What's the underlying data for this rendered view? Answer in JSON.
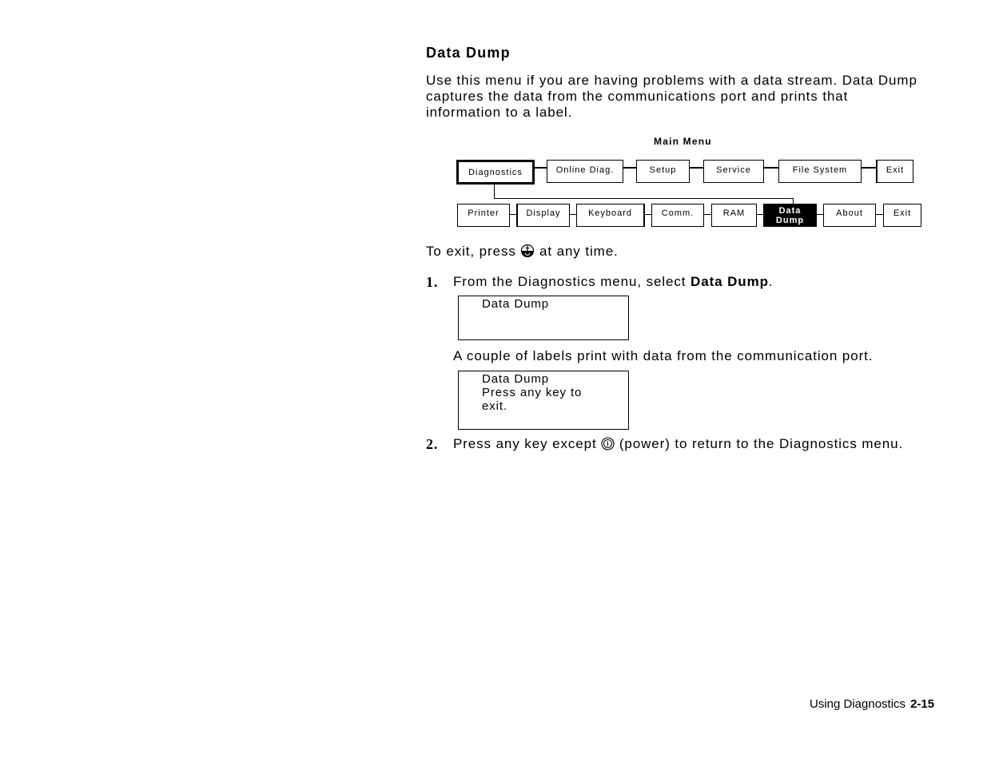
{
  "section": {
    "heading": "Data Dump",
    "intro_lines": [
      "Use this menu if you are having problems with a data stream.  Data Dump",
      "captures the data from the communications port and prints that",
      "information to a label."
    ]
  },
  "diagram": {
    "title": "Main Menu",
    "top_row": [
      {
        "label": "Diagnostics",
        "active": true
      },
      {
        "label": "Online Diag."
      },
      {
        "label": "Setup"
      },
      {
        "label": "Service"
      },
      {
        "label": "File System"
      },
      {
        "label": "Exit"
      }
    ],
    "bottom_row": [
      {
        "label": "Printer"
      },
      {
        "label": "Display"
      },
      {
        "label": "Keyboard"
      },
      {
        "label": "Comm."
      },
      {
        "label": "RAM"
      },
      {
        "label_line1": "Data",
        "label_line2": "Dump",
        "selected": true
      },
      {
        "label": "About"
      },
      {
        "label": "Exit"
      }
    ]
  },
  "exit_note": {
    "before": "To exit, press",
    "icon": "escape-key-icon",
    "after": "at any time."
  },
  "steps": [
    {
      "number": "1.",
      "text_before": "From the Diagnostics menu, select ",
      "text_bold": "Data Dump",
      "text_after": ".",
      "display1": [
        "Data Dump"
      ],
      "note": "A couple of labels print with data from the communication port.",
      "display2": [
        "Data Dump",
        "Press any key to",
        "exit."
      ]
    },
    {
      "number": "2.",
      "text_before": "Press any key except",
      "icon": "power-key-icon",
      "text_after": "(power) to return to the Diagnostics menu."
    }
  ],
  "footer": {
    "chapter": "Using Diagnostics",
    "page": "2-15"
  }
}
